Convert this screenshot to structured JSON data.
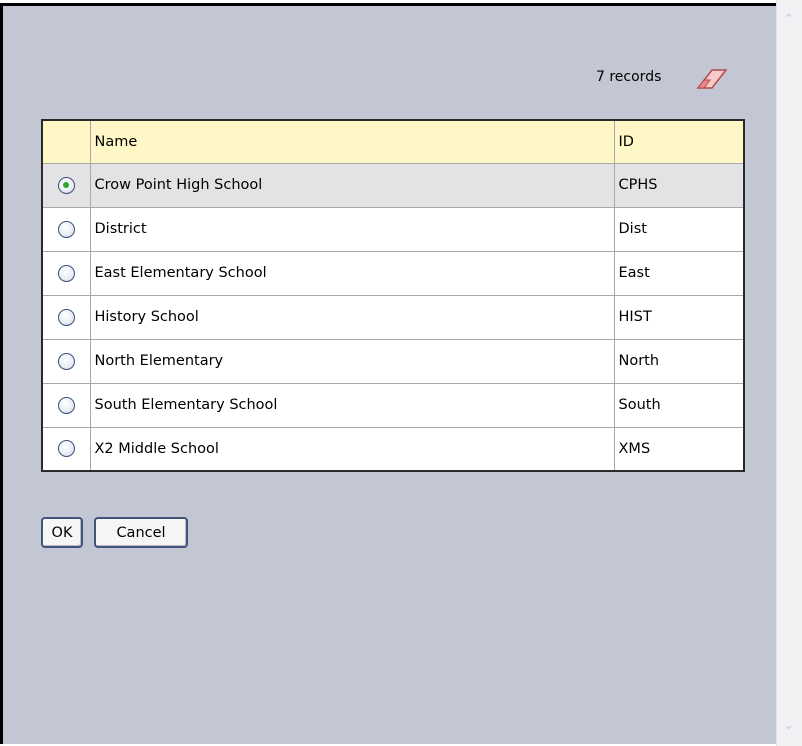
{
  "records_text": "7 records",
  "icons": {
    "eraser": "eraser-icon",
    "radio": "radio-icon"
  },
  "table": {
    "columns": [
      "Name",
      "ID"
    ],
    "rows": [
      {
        "name": "Crow Point High School",
        "id": "CPHS",
        "selected": true
      },
      {
        "name": "District",
        "id": "Dist",
        "selected": false
      },
      {
        "name": "East Elementary School",
        "id": "East",
        "selected": false
      },
      {
        "name": "History School",
        "id": "HIST",
        "selected": false
      },
      {
        "name": "North Elementary",
        "id": "North",
        "selected": false
      },
      {
        "name": "South Elementary School",
        "id": "South",
        "selected": false
      },
      {
        "name": "X2 Middle School",
        "id": "XMS",
        "selected": false
      }
    ]
  },
  "buttons": {
    "ok": "OK",
    "cancel": "Cancel"
  },
  "colors": {
    "header_bg": "#fff8c6",
    "panel_bg": "#c3c7d3",
    "selected_row_bg": "#e3e3e6",
    "radio_dot": "#29a82d"
  }
}
